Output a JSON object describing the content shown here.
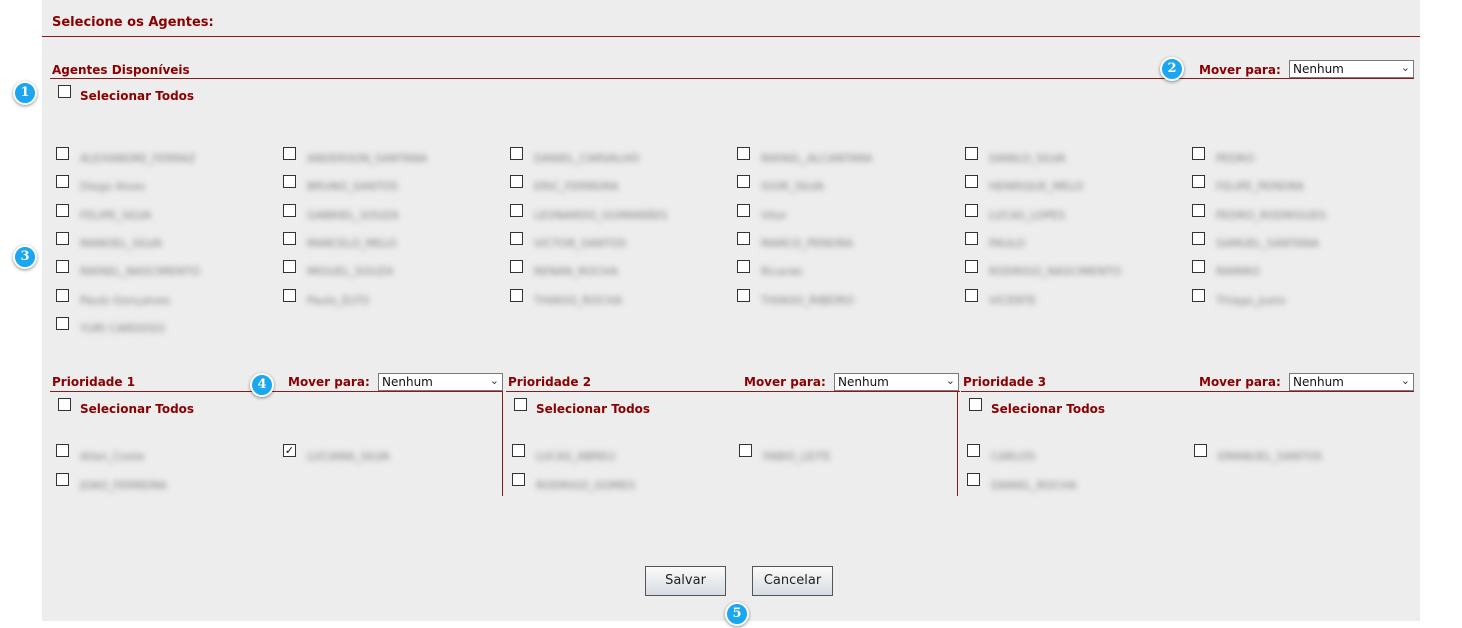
{
  "title": "Selecione os Agentes:",
  "available": {
    "label": "Agentes Disponíveis",
    "mover_label": "Mover para:",
    "mover_value": "Nenhum",
    "select_all": "Selecionar Todos",
    "agents": [
      [
        "ALEXANDRE_FERRAZ",
        "Diego Alves",
        "FELIPE_SILVA",
        "MANOEL_SILVA",
        "RAFAEL_NASCIMENTO",
        "Paulo Gonçalves",
        "YURI CARDOSO"
      ],
      [
        "ANDERSON_SANTANA",
        "BRUNO_SANTOS",
        "GABRIEL_SOUZA",
        "MARCELO_MELO",
        "MIGUEL_SOUZA",
        "Paulo_ELTO"
      ],
      [
        "DANIEL_CARVALHO",
        "ERIC_FERREIRA",
        "LEONARDO_GUIMARÃES",
        "VICTOR_SANTOS",
        "RENAN_ROCHA",
        "THIAGO_ROCHA"
      ],
      [
        "RAFAEL_ALCANTARA",
        "IGOR_SILVA",
        "Vitor",
        "MARCO_PEREIRA",
        "Ricardo",
        "THIAGO_RIBEIRO"
      ],
      [
        "DANILO_SILVA",
        "HENRIQUE_MELO",
        "LUCAS_LOPES",
        "PAULO",
        "RODRIGO_NASCIMENTO",
        "VICENTE"
      ],
      [
        "PEDRO",
        "FELIPE_PEREIRA",
        "PEDRO_RODRIGUES",
        "SAMUEL_SANTANA",
        "RAMIRO",
        "Thiago_Justo"
      ]
    ]
  },
  "priorities": [
    {
      "label": "Prioridade 1",
      "mover_label": "Mover para:",
      "mover_value": "Nenhum",
      "select_all": "Selecionar Todos",
      "agents": [
        [
          "Allan_Costa",
          "JOAO_FERREIRA"
        ],
        [
          "LUCIANA_SILVA"
        ]
      ]
    },
    {
      "label": "Prioridade 2",
      "mover_label": "Mover para:",
      "mover_value": "Nenhum",
      "select_all": "Selecionar Todos",
      "agents": [
        [
          "LUCAS_ABREU",
          "RODRIGO_GOMES"
        ],
        [
          "FABIO_LEITE"
        ]
      ]
    },
    {
      "label": "Prioridade 3",
      "mover_label": "Mover para:",
      "mover_value": "Nenhum",
      "select_all": "Selecionar Todos",
      "agents": [
        [
          "CARLOS",
          "DANIEL_ROCHA"
        ],
        [
          "EMANUEL_SANTOS"
        ]
      ]
    }
  ],
  "checked": {
    "priority": 0,
    "col": 1,
    "row": 0
  },
  "buttons": {
    "save": "Salvar",
    "cancel": "Cancelar"
  },
  "badges": [
    "1",
    "2",
    "3",
    "4",
    "5"
  ]
}
